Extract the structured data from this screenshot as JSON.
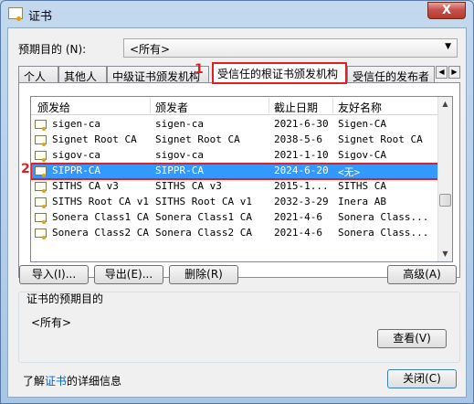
{
  "window": {
    "title": "证书",
    "close_label": "X"
  },
  "purpose": {
    "label": "预期目的 (N):",
    "selected": "<所有>"
  },
  "tabs": [
    {
      "label": "个人"
    },
    {
      "label": "其他人"
    },
    {
      "label": "中级证书颁发机构"
    },
    {
      "label": "受信任的根证书颁发机构"
    },
    {
      "label": "受信任的发布者"
    }
  ],
  "markers": {
    "tab": "1",
    "row": "2"
  },
  "columns": [
    "颁发给",
    "颁发者",
    "截止日期",
    "友好名称"
  ],
  "rows": [
    {
      "issued_to": "sigen-ca",
      "issuer": "sigen-ca",
      "expires": "2021-6-30",
      "friendly": "Sigen-CA"
    },
    {
      "issued_to": "Signet Root CA",
      "issuer": "Signet Root CA",
      "expires": "2038-5-6",
      "friendly": "Signet Root CA"
    },
    {
      "issued_to": "sigov-ca",
      "issuer": "sigov-ca",
      "expires": "2021-1-10",
      "friendly": "Sigov-CA"
    },
    {
      "issued_to": "SIPPR-CA",
      "issuer": "SIPPR-CA",
      "expires": "2024-6-20",
      "friendly": "<无>"
    },
    {
      "issued_to": "SITHS CA v3",
      "issuer": "SITHS CA v3",
      "expires": "2015-1...",
      "friendly": "SITHS CA"
    },
    {
      "issued_to": "SITHS Root CA v1",
      "issuer": "SITHS Root CA v1",
      "expires": "2032-3-29",
      "friendly": "Inera AB"
    },
    {
      "issued_to": "Sonera Class1 CA",
      "issuer": "Sonera Class1 CA",
      "expires": "2021-4-6",
      "friendly": "Sonera Class..."
    },
    {
      "issued_to": "Sonera Class2 CA",
      "issuer": "Sonera Class2 CA",
      "expires": "2021-4-6",
      "friendly": "Sonera Class..."
    }
  ],
  "buttons": {
    "import": "导入(I)...",
    "export": "导出(E)...",
    "remove": "删除(R)",
    "advanced": "高级(A)",
    "view": "查看(V)",
    "close": "关闭(C)"
  },
  "group": {
    "title": "证书的预期目的",
    "value": "<所有>"
  },
  "learn": {
    "prefix": "了解",
    "link": "证书",
    "suffix": "的详细信息"
  }
}
